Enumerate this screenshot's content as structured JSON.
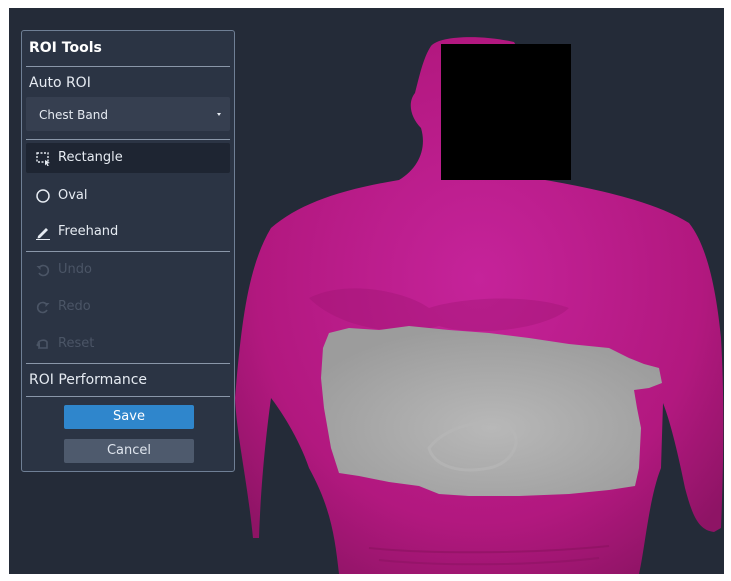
{
  "panel": {
    "title": "ROI Tools",
    "auto_roi": {
      "label": "Auto ROI",
      "selected": "Chest Band"
    },
    "tools": [
      {
        "label": "Rectangle",
        "icon": "rectangle-select-icon",
        "active": true
      },
      {
        "label": "Oval",
        "icon": "oval-icon"
      },
      {
        "label": "Freehand",
        "icon": "pencil-icon"
      }
    ],
    "history": [
      {
        "label": "Undo",
        "icon": "undo-icon",
        "enabled": false
      },
      {
        "label": "Redo",
        "icon": "redo-icon",
        "enabled": false
      },
      {
        "label": "Reset",
        "icon": "reset-icon",
        "enabled": false
      }
    ],
    "performance_label": "ROI Performance",
    "save_label": "Save",
    "cancel_label": "Cancel"
  },
  "colors": {
    "background": "#242b38",
    "body_surface": "#b2187f",
    "roi_region": "#a5a5a5",
    "face_redaction": "#000000",
    "accent": "#2f86cc"
  }
}
